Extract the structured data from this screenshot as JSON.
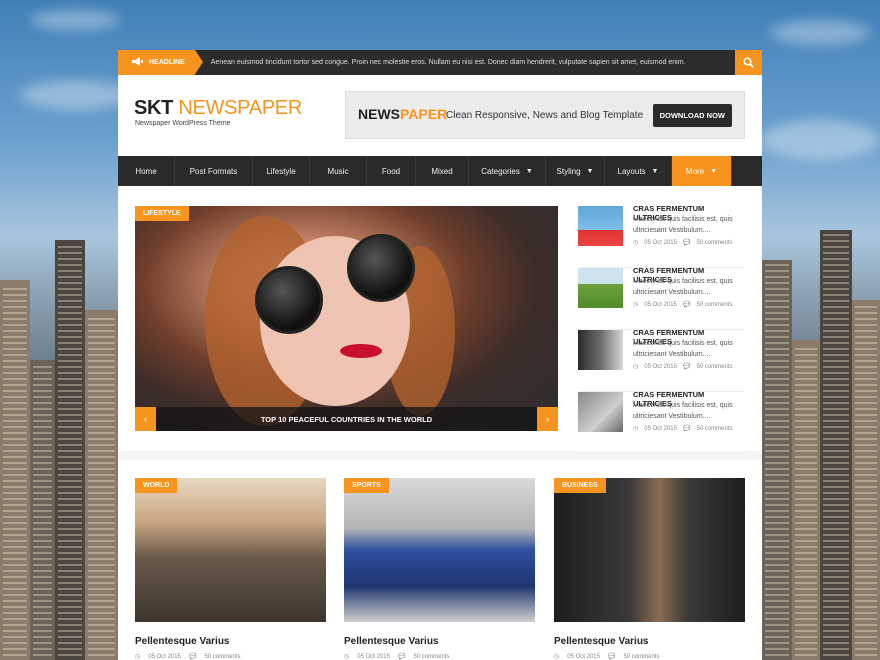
{
  "headline": {
    "label": "HEADLINE",
    "ticker": "Aenean euismod tincidunt tortor sed congue. Proin nec molestie eros. Nullam eu nisi est. Donec diam hendrerit, vulputate sapien sit amet, euismod enim."
  },
  "header": {
    "logo_bold": "SKT",
    "logo_light": "NEWSPAPER",
    "tagline": "Newspaper WordPress Theme",
    "banner": {
      "news": "NEWS",
      "paper": "PAPER",
      "text": "Clean Responsive, News and Blog Template",
      "button": "DOWNLOAD NOW"
    }
  },
  "nav": {
    "items": [
      "Home",
      "Post Formats",
      "Lifestyle",
      "Music",
      "Food",
      "Mixed",
      "Categories",
      "Styling",
      "Layouts",
      "More"
    ]
  },
  "slider": {
    "category": "LIFESTYLE",
    "caption": "TOP 10 PEACEFUL COUNTRIES IN THE WORLD",
    "prev": "‹",
    "next": "›"
  },
  "side_posts": [
    {
      "title": "CRAS FERMENTUM ULTRICIES",
      "excerpt": "Maecenas quis facilisis est, quis ultriciesant Vestibulum....",
      "date": "05 Oct 2015",
      "comments": "50 comments"
    },
    {
      "title": "CRAS FERMENTUM ULTRICIES",
      "excerpt": "Maecenas quis facilisis est, quis ultriciesant Vestibulum....",
      "date": "05 Oct 2015",
      "comments": "50 comments"
    },
    {
      "title": "CRAS FERMENTUM ULTRICIES",
      "excerpt": "Maecenas quis facilisis est, quis ultriciesant Vestibulum....",
      "date": "05 Oct 2015",
      "comments": "50 comments"
    },
    {
      "title": "CRAS FERMENTUM ULTRICIES",
      "excerpt": "Maecenas quis facilisis est, quis ultriciesant Vestibulum....",
      "date": "05 Oct 2015",
      "comments": "50 comments"
    }
  ],
  "cards": [
    {
      "category": "WORLD",
      "title": "Pellentesque Varius",
      "date": "05 Oct 2015",
      "comments": "50 comments"
    },
    {
      "category": "SPORTS",
      "title": "Pellentesque Varius",
      "date": "05 Oct 2015",
      "comments": "50 comments"
    },
    {
      "category": "BUSINESS",
      "title": "Pellentesque Varius",
      "date": "05 Oct 2015",
      "comments": "50 comments"
    }
  ],
  "colors": {
    "accent": "#f7941d",
    "dark": "#2a2a2a"
  },
  "icons": {
    "headline": "megaphone-icon",
    "search": "search-icon",
    "date": "clock-icon",
    "comments": "comment-icon"
  }
}
